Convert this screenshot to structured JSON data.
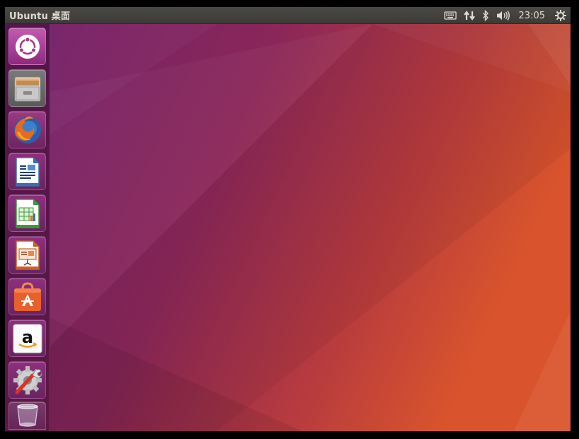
{
  "panel": {
    "title": "Ubuntu 桌面",
    "clock": "23:05",
    "indicators": [
      "keyboard-icon",
      "network-icon",
      "bluetooth-icon",
      "volume-icon",
      "power-gear-icon"
    ]
  },
  "launcher": {
    "items": [
      {
        "name": "dash-home",
        "icon": "ubuntu-logo-icon",
        "color": "#a0368d"
      },
      {
        "name": "files",
        "icon": "file-cabinet-icon",
        "color": "#8c8c8c"
      },
      {
        "name": "firefox",
        "icon": "firefox-icon",
        "color": "#3a6ab0"
      },
      {
        "name": "libreoffice-writer",
        "icon": "writer-document-icon",
        "color": "#2a6fb0"
      },
      {
        "name": "libreoffice-calc",
        "icon": "calc-spreadsheet-icon",
        "color": "#43a047"
      },
      {
        "name": "libreoffice-impress",
        "icon": "impress-presentation-icon",
        "color": "#c8612a"
      },
      {
        "name": "ubuntu-software",
        "icon": "shopping-bag-icon",
        "color": "#e2622e"
      },
      {
        "name": "amazon",
        "icon": "amazon-icon",
        "color": "#d0d0d0"
      },
      {
        "name": "system-settings",
        "icon": "settings-gear-wrench-icon",
        "color": "#a0a0a0"
      },
      {
        "name": "trash",
        "icon": "trash-icon",
        "color": "#b0b0c0"
      }
    ]
  },
  "colors": {
    "wallpaper_left": "#6b1e66",
    "wallpaper_right": "#d9542c",
    "panel_bg": "#3c3b37",
    "panel_text": "#dfdbd2"
  }
}
